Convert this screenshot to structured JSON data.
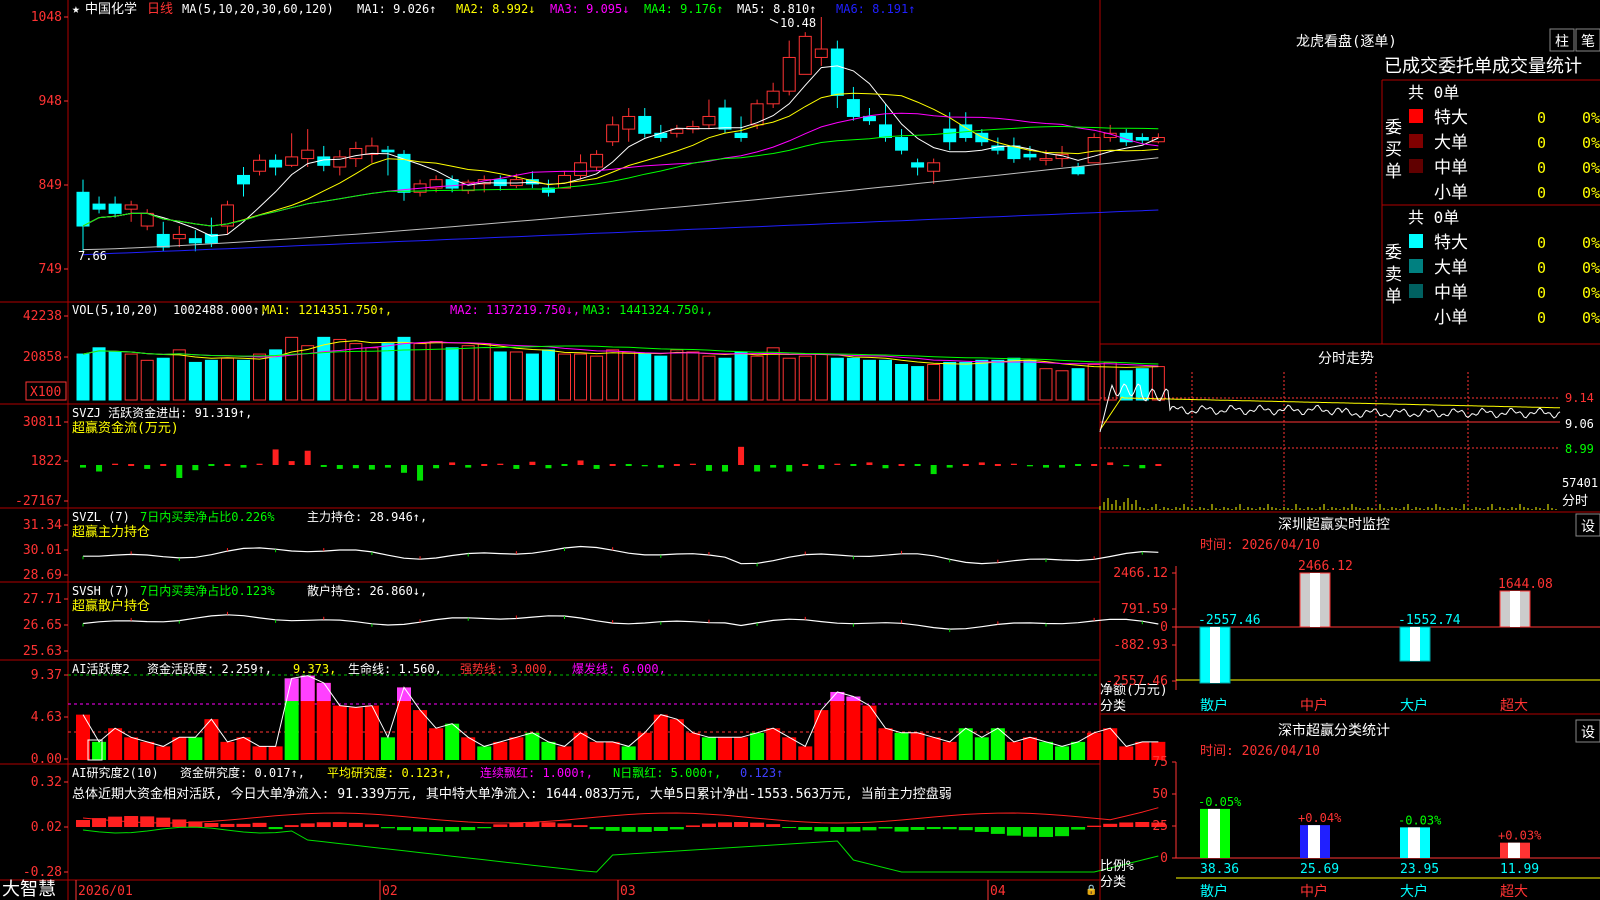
{
  "stock": {
    "star": "★",
    "name": "中国化学",
    "period": "日线"
  },
  "colors": {
    "up": "#ff3333",
    "down": "#00ffff",
    "frame": "#c00000",
    "ma1": "#ffffff",
    "ma2": "#ffff00",
    "ma3": "#ff00ff",
    "ma4": "#00ff00",
    "ma5": "#c0c0c0",
    "ma6": "#2020ff"
  },
  "price_panel": {
    "label": "MA(5,10,20,30,60,120)",
    "ma_values": [
      {
        "name": "MA1",
        "value": "9.026",
        "dir": "↑"
      },
      {
        "name": "MA2",
        "value": "8.992",
        "dir": "↓"
      },
      {
        "name": "MA3",
        "value": "9.095",
        "dir": "↓"
      },
      {
        "name": "MA4",
        "value": "9.176",
        "dir": "↑"
      },
      {
        "name": "MA5",
        "value": "8.810",
        "dir": "↑"
      },
      {
        "name": "MA6",
        "value": "8.191",
        "dir": "↑"
      }
    ],
    "y_ticks": [
      "1048",
      "948",
      "849",
      "749"
    ],
    "high_mark": "10.48",
    "low_mark": "7.66"
  },
  "vol_panel": {
    "label": "VOL(5,10,20)",
    "values": [
      {
        "name": "",
        "value": "1002488.000",
        "dir": "↑"
      },
      {
        "name": "MA1",
        "value": "1214351.750",
        "dir": "↑"
      },
      {
        "name": "MA2",
        "value": "1137219.750",
        "dir": "↓"
      },
      {
        "name": "MA3",
        "value": "1441324.750",
        "dir": "↓"
      }
    ],
    "y_ticks": [
      "42238",
      "20858"
    ],
    "unit": "X100"
  },
  "svzj_panel": {
    "line1": "SVZJ  活跃资金进出: 91.319↑,",
    "line2": "超赢资金流(万元)",
    "y_ticks": [
      "30811",
      "1822",
      "-27167"
    ]
  },
  "svzl_panel": {
    "label": "SVZL (7)",
    "text1": "7日内买卖净占比0.226%",
    "text2": "主力持仓: 28.946↑,",
    "line2": "超赢主力持仓",
    "y_ticks": [
      "31.34",
      "30.01",
      "28.69"
    ]
  },
  "svsh_panel": {
    "label": "SVSH (7)",
    "text1": "7日内买卖净占比0.123%",
    "text2": "散户持仓: 26.860↓,",
    "line2": "超赢散户持仓",
    "y_ticks": [
      "27.71",
      "26.65",
      "25.63"
    ]
  },
  "ai_panel": {
    "label": "AI活跃度2",
    "t1": "资金活跃度: 2.259↑,",
    "t2": "9.373,",
    "t3": "生命线: 1.560,",
    "t4": "强势线: 3.000,",
    "t5": "爆发线: 6.000,",
    "y_ticks": [
      "9.37",
      "4.63",
      "0.00"
    ]
  },
  "ai2_panel": {
    "label": "AI研究度2(10)",
    "t1": "资金研究度: 0.017↑,",
    "t2": "平均研究度: 0.123↑,",
    "t3": "连续飘红: 1.000↑,",
    "t4": "N日飘红: 5.000↑,",
    "t5": "0.123↑",
    "summary": "总体近期大资金相对活跃, 今日大单净流入: 91.339万元, 其中特大单净流入: 1644.083万元, 大单5日累计净出-1553.563万元, 当前主力控盘弱",
    "y_ticks": [
      "0.32",
      "0.02",
      "-0.28"
    ]
  },
  "x_axis": {
    "labels": [
      "2026/01",
      "02",
      "03",
      "04"
    ]
  },
  "brand": "大智慧",
  "dragon": {
    "title": "龙虎看盘(逐单)",
    "btn1": "柱",
    "btn2": "笔",
    "subtitle": "已成交委托单成交量统计",
    "buy": {
      "side": "委买单",
      "total": "共 0单",
      "rows": [
        {
          "label": "特大",
          "count": "0",
          "pct": "0%",
          "color": "#ff0000"
        },
        {
          "label": "大单",
          "count": "0",
          "pct": "0%",
          "color": "#800000"
        },
        {
          "label": "中单",
          "count": "0",
          "pct": "0%",
          "color": "#600000"
        },
        {
          "label": "小单",
          "count": "0",
          "pct": "0%",
          "color": "#000000"
        }
      ]
    },
    "sell": {
      "side": "委卖单",
      "total": "共 0单",
      "rows": [
        {
          "label": "特大",
          "count": "0",
          "pct": "0%",
          "color": "#00ffff"
        },
        {
          "label": "大单",
          "count": "0",
          "pct": "0%",
          "color": "#008080"
        },
        {
          "label": "中单",
          "count": "0",
          "pct": "0%",
          "color": "#006060"
        },
        {
          "label": "小单",
          "count": "0",
          "pct": "0%",
          "color": "#000000"
        }
      ]
    }
  },
  "intraday": {
    "title": "分时走势",
    "y_ticks": [
      "9.14",
      "9.06",
      "8.99"
    ],
    "vol_tick": "57401",
    "vol_unit": "分时"
  },
  "sz_monitor": {
    "title": "深圳超赢实时监控",
    "set_btn": "设",
    "time": "时间: 2026/04/10",
    "y_ticks": [
      "2466.12",
      "791.59",
      "0",
      "-882.93",
      "-2557.46"
    ],
    "y_label": "净额(万元)",
    "x_label": "分类",
    "bars": [
      {
        "cat": "散户",
        "value": -2557.46,
        "text": "-2557.46"
      },
      {
        "cat": "中户",
        "value": 2466.12,
        "text": "2466.12"
      },
      {
        "cat": "大户",
        "value": -1552.74,
        "text": "-1552.74"
      },
      {
        "cat": "超大",
        "value": 1644.08,
        "text": "1644.08"
      }
    ]
  },
  "sz_class": {
    "title": "深市超赢分类统计",
    "set_btn": "设",
    "time": "时间: 2026/04/10",
    "y_ticks": [
      "75",
      "50",
      "25",
      "0"
    ],
    "y_label": "比例%",
    "x_label": "分类",
    "bars": [
      {
        "cat": "散户",
        "value": 38.36,
        "label": "38.36",
        "change": "-0.05%"
      },
      {
        "cat": "中户",
        "value": 25.69,
        "label": "25.69",
        "change": "+0.04%"
      },
      {
        "cat": "大户",
        "value": 23.95,
        "label": "23.95",
        "change": "-0.03%"
      },
      {
        "cat": "超大",
        "value": 11.99,
        "label": "11.99",
        "change": "+0.03%"
      }
    ]
  },
  "chart_data": [
    {
      "type": "candlestick",
      "title": "中国化学 日线",
      "ylim": [
        7.49,
        10.48
      ],
      "x_labels": [
        "2026/01",
        "02",
        "03",
        "04"
      ],
      "ohlc": [
        [
          8.4,
          8.55,
          7.7,
          8.0
        ],
        [
          8.26,
          8.35,
          8.15,
          8.2
        ],
        [
          8.26,
          8.35,
          8.1,
          8.15
        ],
        [
          8.2,
          8.3,
          8.05,
          8.25
        ],
        [
          8.0,
          8.2,
          7.95,
          8.15
        ],
        [
          7.9,
          8.05,
          7.7,
          7.75
        ],
        [
          7.85,
          8.0,
          7.75,
          7.9
        ],
        [
          7.85,
          7.95,
          7.7,
          7.8
        ],
        [
          7.9,
          8.1,
          7.75,
          7.8
        ],
        [
          8.0,
          8.3,
          7.9,
          8.25
        ],
        [
          8.6,
          8.7,
          8.35,
          8.5
        ],
        [
          8.65,
          8.85,
          8.6,
          8.78
        ],
        [
          8.78,
          8.85,
          8.6,
          8.7
        ],
        [
          8.72,
          9.1,
          8.7,
          8.82
        ],
        [
          8.8,
          9.15,
          8.7,
          8.9
        ],
        [
          8.82,
          8.95,
          8.65,
          8.72
        ],
        [
          8.7,
          8.9,
          8.6,
          8.82
        ],
        [
          8.8,
          9.0,
          8.7,
          8.92
        ],
        [
          8.85,
          9.05,
          8.75,
          8.95
        ],
        [
          8.9,
          8.95,
          8.6,
          8.88
        ],
        [
          8.85,
          8.9,
          8.3,
          8.4
        ],
        [
          8.4,
          8.55,
          8.35,
          8.5
        ],
        [
          8.45,
          8.6,
          8.4,
          8.55
        ],
        [
          8.55,
          8.6,
          8.4,
          8.45
        ],
        [
          8.42,
          8.55,
          8.38,
          8.52
        ],
        [
          8.5,
          8.6,
          8.4,
          8.55
        ],
        [
          8.55,
          8.6,
          8.42,
          8.48
        ],
        [
          8.48,
          8.62,
          8.45,
          8.55
        ],
        [
          8.55,
          8.65,
          8.45,
          8.5
        ],
        [
          8.45,
          8.55,
          8.35,
          8.4
        ],
        [
          8.45,
          8.65,
          8.45,
          8.6
        ],
        [
          8.6,
          8.85,
          8.55,
          8.75
        ],
        [
          8.7,
          8.9,
          8.65,
          8.85
        ],
        [
          9.0,
          9.3,
          8.95,
          9.2
        ],
        [
          9.15,
          9.4,
          9.0,
          9.3
        ],
        [
          9.3,
          9.4,
          9.05,
          9.1
        ],
        [
          9.1,
          9.2,
          9.0,
          9.05
        ],
        [
          9.1,
          9.2,
          9.05,
          9.15
        ],
        [
          9.15,
          9.25,
          9.1,
          9.18
        ],
        [
          9.2,
          9.5,
          9.15,
          9.3
        ],
        [
          9.4,
          9.5,
          9.1,
          9.15
        ],
        [
          9.1,
          9.3,
          9.0,
          9.05
        ],
        [
          9.2,
          9.5,
          9.15,
          9.45
        ],
        [
          9.45,
          9.7,
          9.4,
          9.6
        ],
        [
          9.6,
          10.2,
          9.55,
          10.0
        ],
        [
          9.8,
          10.3,
          9.8,
          10.25
        ],
        [
          10.0,
          10.48,
          9.9,
          10.1
        ],
        [
          10.1,
          10.2,
          9.4,
          9.55
        ],
        [
          9.5,
          9.65,
          9.25,
          9.3
        ],
        [
          9.3,
          9.4,
          9.2,
          9.25
        ],
        [
          9.2,
          9.45,
          9.0,
          9.05
        ],
        [
          9.05,
          9.15,
          8.85,
          8.9
        ],
        [
          8.75,
          8.8,
          8.6,
          8.7
        ],
        [
          8.65,
          8.8,
          8.5,
          8.75
        ],
        [
          9.15,
          9.35,
          8.9,
          9.0
        ],
        [
          9.2,
          9.35,
          9.0,
          9.05
        ],
        [
          9.1,
          9.15,
          8.95,
          9.0
        ],
        [
          8.95,
          9.05,
          8.85,
          8.9
        ],
        [
          8.95,
          9.05,
          8.75,
          8.8
        ],
        [
          8.85,
          8.95,
          8.78,
          8.82
        ],
        [
          8.78,
          8.9,
          8.72,
          8.8
        ],
        [
          8.8,
          8.95,
          8.7,
          8.85
        ],
        [
          8.7,
          8.75,
          8.6,
          8.62
        ],
        [
          8.75,
          9.1,
          8.75,
          9.05
        ],
        [
          9.05,
          9.2,
          9.0,
          9.1
        ],
        [
          9.1,
          9.15,
          8.95,
          9.0
        ],
        [
          9.05,
          9.1,
          8.98,
          9.02
        ],
        [
          9.0,
          9.1,
          8.98,
          9.05
        ]
      ]
    },
    {
      "type": "bar",
      "title": "VOL(5,10,20)",
      "values": [
        22000,
        25000,
        23000,
        22000,
        19000,
        20000,
        24000,
        18000,
        19000,
        20000,
        19000,
        22000,
        24000,
        30000,
        26000,
        30000,
        29000,
        27000,
        25000,
        27000,
        30000,
        27000,
        28000,
        25000,
        26000,
        27000,
        23000,
        23000,
        22000,
        24000,
        22000,
        22000,
        21000,
        24000,
        23000,
        22000,
        21000,
        24000,
        23000,
        21000,
        20000,
        23000,
        21000,
        25000,
        20000,
        21000,
        22000,
        20000,
        20000,
        19000,
        19000,
        17000,
        16000,
        17000,
        18000,
        18000,
        19000,
        19000,
        20000,
        19000,
        15000,
        14000,
        15000,
        17000,
        18000,
        14000,
        15000,
        16000
      ]
    },
    {
      "type": "bar",
      "title": "超赢资金流(万元)",
      "values": [
        -2000,
        -5000,
        1000,
        0,
        -3000,
        0,
        -10000,
        -4000,
        0,
        0,
        -2000,
        1000,
        12000,
        3000,
        11000,
        -1500,
        -3000,
        -2500,
        -3500,
        -2000,
        -6000,
        -12000,
        -2500,
        2000,
        -2000,
        0,
        1000,
        -3000,
        2500,
        -2500,
        0,
        3500,
        -3000,
        0,
        0,
        -1000,
        -2000,
        0,
        1000,
        -4500,
        -5000,
        14000,
        -5000,
        -2000,
        -5000,
        0,
        -3000,
        1000,
        0,
        2000,
        -2500,
        0,
        0,
        -7000,
        -2000,
        0,
        2000,
        0,
        1000,
        -1000,
        -2000,
        -2000,
        0,
        0,
        2000,
        -1000,
        -2500,
        0
      ]
    },
    {
      "type": "bar",
      "title": "AI活跃度2",
      "values": [
        5.0,
        2.0,
        3.5,
        2.5,
        2.0,
        1.5,
        2.5,
        2.5,
        4.5,
        2.0,
        2.5,
        1.5,
        1.5,
        9.0,
        9.3,
        8.5,
        6.0,
        5.8,
        6.0,
        2.5,
        8.0,
        5.5,
        3.5,
        4.0,
        2.5,
        1.5,
        2.0,
        2.5,
        3.0,
        2.0,
        1.5,
        3.0,
        2.0,
        2.0,
        1.5,
        3.0,
        5.0,
        4.5,
        3.0,
        2.5,
        2.5,
        2.5,
        3.0,
        3.5,
        2.5,
        1.5,
        5.5,
        7.5,
        7.0,
        6.0,
        3.5,
        3.0,
        3.0,
        2.5,
        2.0,
        3.5,
        2.5,
        3.5,
        2.0,
        2.5,
        2.0,
        1.5,
        2.0,
        3.0,
        3.5,
        1.5,
        2.0,
        2.0
      ]
    },
    {
      "type": "bar",
      "title": "深圳超赢实时监控",
      "categories": [
        "散户",
        "中户",
        "大户",
        "超大"
      ],
      "values": [
        -2557.46,
        2466.12,
        -1552.74,
        1644.08
      ],
      "ylabel": "净额(万元)",
      "xlabel": "分类"
    },
    {
      "type": "bar",
      "title": "深市超赢分类统计",
      "categories": [
        "散户",
        "中户",
        "大户",
        "超大"
      ],
      "values": [
        38.36,
        25.69,
        23.95,
        11.99
      ],
      "ylabel": "比例%",
      "xlabel": "分类",
      "ylim": [
        0,
        75
      ]
    }
  ]
}
